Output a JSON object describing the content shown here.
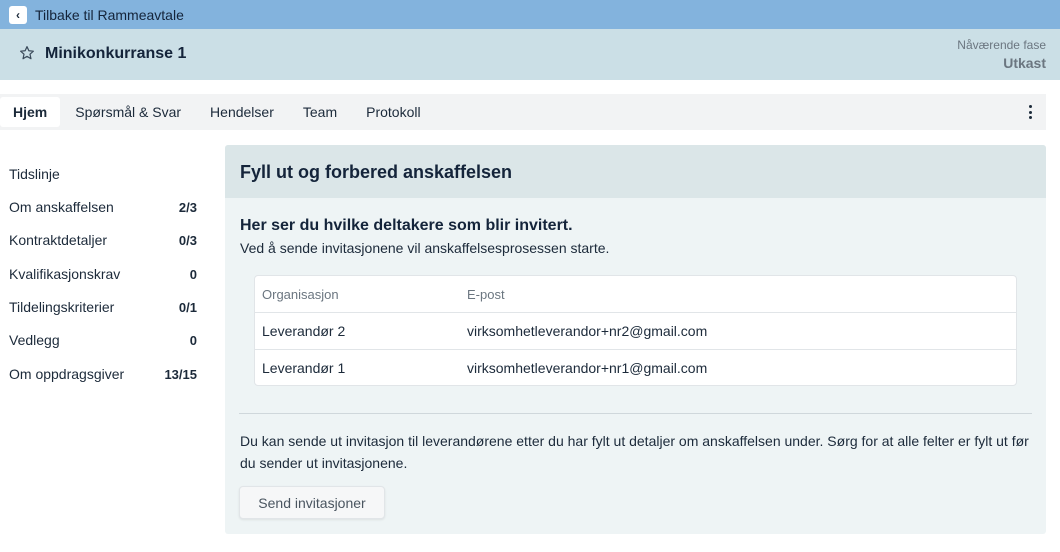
{
  "topbar": {
    "back_label": "Tilbake til Rammeavtale",
    "back_icon": "chevron-left-icon"
  },
  "header": {
    "title": "Minikonkurranse 1",
    "star_icon": "star-icon",
    "phase_label": "Nåværende fase",
    "phase_value": "Utkast"
  },
  "tabs": [
    {
      "label": "Hjem",
      "active": true
    },
    {
      "label": "Spørsmål & Svar",
      "active": false
    },
    {
      "label": "Hendelser",
      "active": false
    },
    {
      "label": "Team",
      "active": false
    },
    {
      "label": "Protokoll",
      "active": false
    }
  ],
  "sidebar": {
    "items": [
      {
        "label": "Tidslinje",
        "count": ""
      },
      {
        "label": "Om anskaffelsen",
        "count": "2/3"
      },
      {
        "label": "Kontraktdetaljer",
        "count": "0/3"
      },
      {
        "label": "Kvalifikasjonskrav",
        "count": "0"
      },
      {
        "label": "Tildelingskriterier",
        "count": "0/1"
      },
      {
        "label": "Vedlegg",
        "count": "0"
      },
      {
        "label": "Om oppdragsgiver",
        "count": "13/15"
      }
    ]
  },
  "main": {
    "title": "Fyll ut og forbered anskaffelsen",
    "subheading": "Her ser du hvilke deltakere som blir invitert.",
    "subtext": "Ved å sende invitasjonene vil anskaffelsesprosessen starte.",
    "table": {
      "headers": [
        "Organisasjon",
        "E-post"
      ],
      "rows": [
        [
          "Leverandør 2",
          "virksomhetleverandor+nr2@gmail.com"
        ],
        [
          "Leverandør 1",
          "virksomhetleverandor+nr1@gmail.com"
        ]
      ]
    },
    "info": "Du kan sende ut invitasjon til leverandørene etter du har fylt ut detaljer om anskaffelsen under. Sørg for at alle felter er fylt ut før du sender ut invitasjonene.",
    "send_button": "Send invitasjoner"
  },
  "colors": {
    "topbar": "#83b3dd",
    "header": "#cbdfe6",
    "panel": "#eef4f5",
    "panel_head": "#dbe6e8"
  }
}
